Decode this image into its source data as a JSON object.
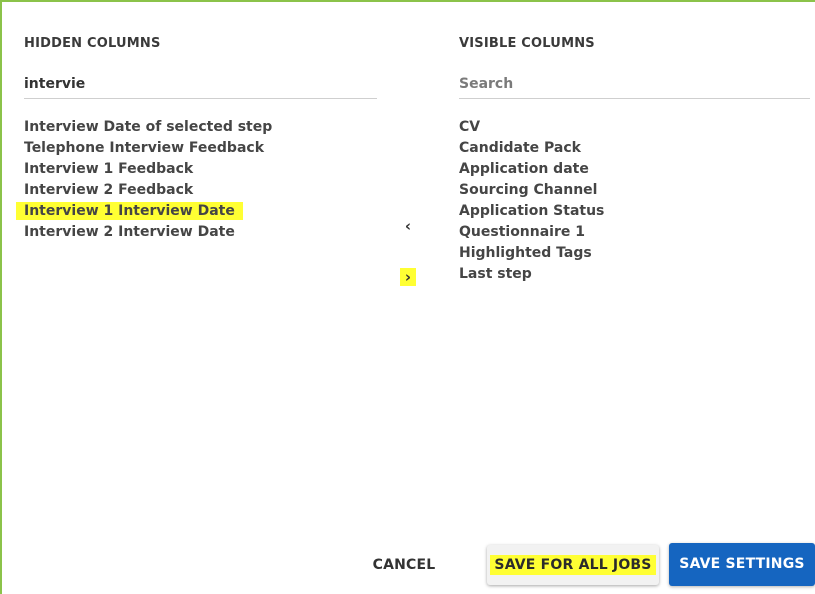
{
  "hidden": {
    "title": "HIDDEN COLUMNS",
    "search_value": "intervie",
    "items": [
      "Interview Date of selected step",
      "Telephone Interview Feedback",
      "Interview 1 Feedback",
      "Interview 2 Feedback",
      "Interview 1 Interview Date",
      "Interview 2 Interview Date"
    ],
    "selected_item": "Interview 1 Interview Date"
  },
  "visible": {
    "title": "VISIBLE COLUMNS",
    "search_placeholder": "Search",
    "items": [
      "CV",
      "Candidate Pack",
      "Application date",
      "Sourcing Channel",
      "Application Status",
      "Questionnaire 1",
      "Highlighted Tags",
      "Last step"
    ]
  },
  "transfer": {
    "move_left_icon": "‹",
    "move_right_icon": "›"
  },
  "footer": {
    "cancel_label": "CANCEL",
    "save_all_label": "SAVE FOR ALL JOBS",
    "save_label": "SAVE SETTINGS"
  },
  "colors": {
    "highlight": "#ffff33",
    "primary_button": "#1565c0",
    "frame_border": "#8bc34a"
  }
}
